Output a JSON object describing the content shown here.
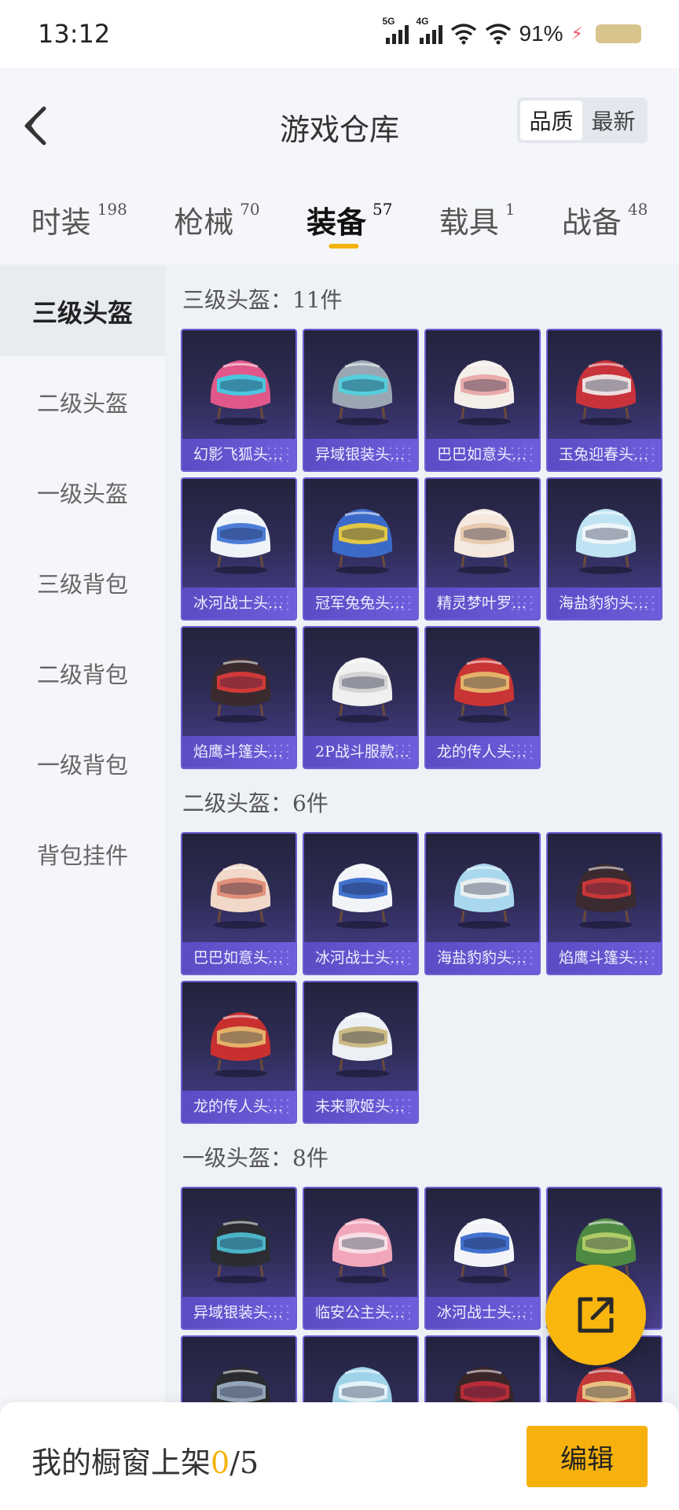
{
  "status_bar": {
    "time": "13:12",
    "net1": "5G",
    "net2": "4G",
    "battery_text": "91%"
  },
  "header": {
    "title": "游戏仓库",
    "sort_options": [
      "品质",
      "最新"
    ],
    "active_sort": "品质"
  },
  "tabs": [
    {
      "label": "时装",
      "count": "198"
    },
    {
      "label": "枪械",
      "count": "70"
    },
    {
      "label": "装备",
      "count": "57",
      "active": true
    },
    {
      "label": "载具",
      "count": "1"
    },
    {
      "label": "战备",
      "count": "48"
    }
  ],
  "sidebar": [
    "三级头盔",
    "二级头盔",
    "一级头盔",
    "三级背包",
    "二级背包",
    "一级背包",
    "背包挂件"
  ],
  "sections": [
    {
      "title": "三级头盔：11件",
      "items": [
        {
          "label": "幻影飞狐头…",
          "icon": "helmet-icon",
          "color": "#e0588a",
          "accent": "#3bd1e8"
        },
        {
          "label": "异域银装头…",
          "icon": "helmet-icon",
          "color": "#9aa7b3",
          "accent": "#4fd3e0"
        },
        {
          "label": "巴巴如意头…",
          "icon": "helmet-icon",
          "color": "#f3eee8",
          "accent": "#e8a4a4"
        },
        {
          "label": "玉兔迎春头…",
          "icon": "helmet-icon",
          "color": "#c8323a",
          "accent": "#f1f1f1"
        },
        {
          "label": "冰河战士头…",
          "icon": "helmet-icon",
          "color": "#eef3f8",
          "accent": "#3b6fd1"
        },
        {
          "label": "冠军兔兔头…",
          "icon": "helmet-icon",
          "color": "#3c6ac9",
          "accent": "#f2d23a"
        },
        {
          "label": "精灵梦叶罗…",
          "icon": "helmet-icon",
          "color": "#f4e8df",
          "accent": "#e6c6a8"
        },
        {
          "label": "海盐豹豹头…",
          "icon": "helmet-icon",
          "color": "#bfe3f2",
          "accent": "#f3f7fa"
        },
        {
          "label": "焰鹰斗篷头…",
          "icon": "helmet-icon",
          "color": "#3a2a2e",
          "accent": "#e23b3b"
        },
        {
          "label": "2P战斗服款…",
          "icon": "helmet-icon",
          "color": "#f0f0f0",
          "accent": "#d0d0d0"
        },
        {
          "label": "龙的传人头…",
          "icon": "helmet-icon",
          "color": "#c93434",
          "accent": "#e8c070"
        }
      ]
    },
    {
      "title": "二级头盔：6件",
      "items": [
        {
          "label": "巴巴如意头…",
          "icon": "helmet-icon",
          "color": "#f1d8c9",
          "accent": "#e08870"
        },
        {
          "label": "冰河战士头…",
          "icon": "helmet-icon",
          "color": "#f2f4f8",
          "accent": "#2f63c8"
        },
        {
          "label": "海盐豹豹头…",
          "icon": "helmet-icon",
          "color": "#a9d8ee",
          "accent": "#f2f2f2"
        },
        {
          "label": "焰鹰斗篷头…",
          "icon": "helmet-icon",
          "color": "#3b2a30",
          "accent": "#d83a3a"
        },
        {
          "label": "龙的传人头…",
          "icon": "helmet-icon",
          "color": "#c83030",
          "accent": "#e8c070"
        },
        {
          "label": "未来歌姬头…",
          "icon": "helmet-icon",
          "color": "#eceff3",
          "accent": "#c9b47a"
        }
      ]
    },
    {
      "title": "一级头盔：8件",
      "items": [
        {
          "label": "异域银装头…",
          "icon": "helmet-icon",
          "color": "#2b2d33",
          "accent": "#4fc3d6"
        },
        {
          "label": "临安公主头…",
          "icon": "helmet-icon",
          "color": "#f2a6bb",
          "accent": "#f6e6ea"
        },
        {
          "label": "冰河战士头…",
          "icon": "helmet-icon",
          "color": "#f2f4f8",
          "accent": "#2f63c8"
        },
        {
          "label": "",
          "icon": "helmet-icon",
          "color": "#4f8a44",
          "accent": "#b8d26a"
        },
        {
          "label": "",
          "icon": "helmet-icon",
          "color": "#2a2b30",
          "accent": "#9fb2c6"
        },
        {
          "label": "",
          "icon": "helmet-icon",
          "color": "#9fd3ea",
          "accent": "#eaf6fb"
        },
        {
          "label": "",
          "icon": "helmet-icon",
          "color": "#3a2529",
          "accent": "#c82f3a"
        },
        {
          "label": "",
          "icon": "helmet-icon",
          "color": "#c53a3a",
          "accent": "#ead08a"
        }
      ]
    }
  ],
  "bottom": {
    "showcase_prefix": "我的橱窗上架",
    "showcase_current": "0",
    "showcase_total": "/5",
    "edit_label": "编辑"
  },
  "colors": {
    "accent": "#f5b30a",
    "card_border": "#6c5fd3"
  }
}
